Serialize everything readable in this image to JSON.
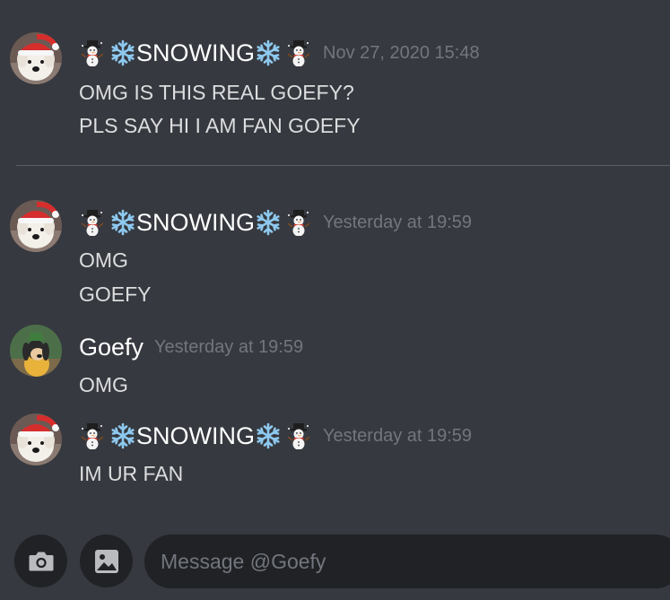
{
  "messages": [
    {
      "author": "SNOWING",
      "timestamp": "Nov 27, 2020 15:48",
      "lines": [
        "OMG IS THIS REAL GOEFY?",
        "PLS SAY HI I AM FAN GOEFY"
      ]
    },
    {
      "author": "SNOWING",
      "timestamp": "Yesterday at 19:59",
      "lines": [
        "OMG",
        "GOEFY"
      ]
    },
    {
      "author": "Goefy",
      "timestamp": "Yesterday at 19:59",
      "lines": [
        "OMG"
      ]
    },
    {
      "author": "SNOWING",
      "timestamp": "Yesterday at 19:59",
      "lines": [
        "IM UR FAN"
      ]
    }
  ],
  "composer": {
    "placeholder": "Message @Goefy"
  },
  "icons": {
    "camera": "camera-icon",
    "gallery": "image-icon",
    "snowman": "snowman-emoji",
    "snowflake": "snowflake-emoji",
    "avatar_snowing": "dog-santa-hat-avatar",
    "avatar_goefy": "goofy-avatar"
  },
  "colors": {
    "background": "#36393f",
    "input_background": "#202225",
    "username": "#ffffff",
    "message_text": "#dcddde",
    "timestamp": "#72767d",
    "santa_hat": "#d62d2d"
  }
}
